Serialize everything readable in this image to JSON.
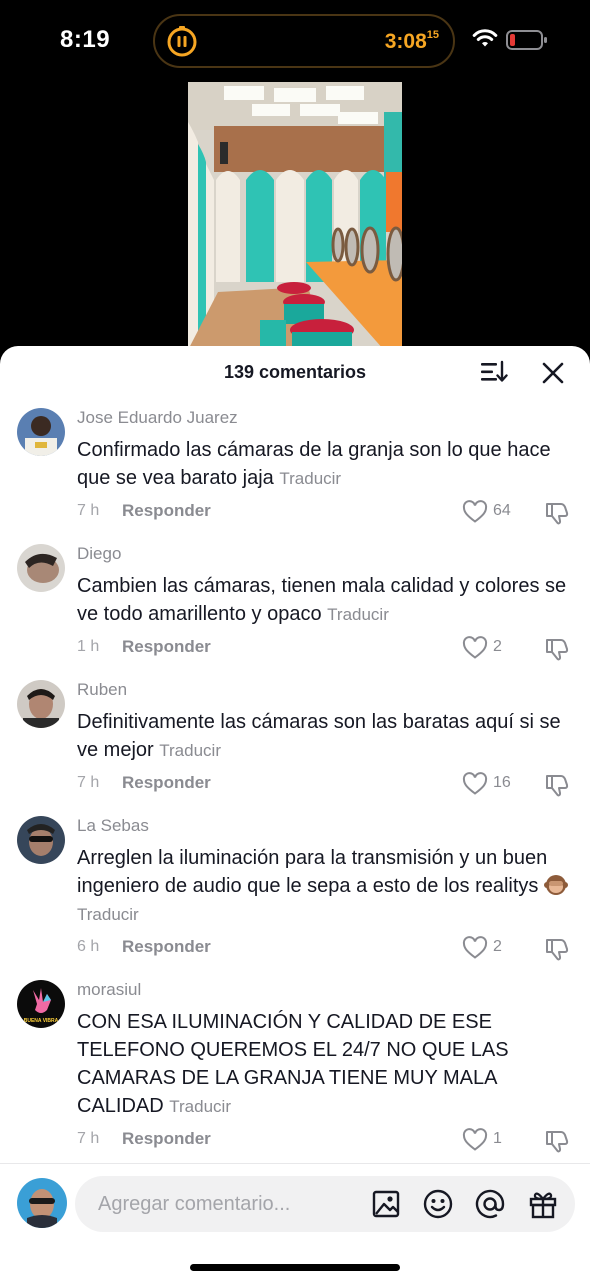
{
  "status": {
    "time": "8:19",
    "timer_main": "3:08",
    "timer_sup": "15",
    "battery_color": "#e53935",
    "timer_color": "#f6a623"
  },
  "sheet": {
    "count_label": "139 comentarios"
  },
  "comments": [
    {
      "user": "Jose Eduardo Juarez",
      "text": "Confirmado las cámaras de la granja son lo que hace que se vea barato jaja",
      "translate": "Traducir",
      "time": "7 h",
      "reply": "Responder",
      "likes": "64"
    },
    {
      "user": "Diego",
      "text": "Cambien las cámaras, tienen mala calidad y colores se ve todo amarillento y opaco",
      "translate": "Traducir",
      "time": "1 h",
      "reply": "Responder",
      "likes": "2"
    },
    {
      "user": "Ruben",
      "text": "Definitivamente las cámaras son las baratas aquí si se ve mejor",
      "translate": "Traducir",
      "time": "7 h",
      "reply": "Responder",
      "likes": "16"
    },
    {
      "user": "La Sebas",
      "text": "Arreglen la iluminación para la transmisión y un buen ingeniero de audio que le sepa a esto de los realitys",
      "translate": "Traducir",
      "time": "6 h",
      "reply": "Responder",
      "likes": "2",
      "emoji": "monkey-emoji"
    },
    {
      "user": "morasiul",
      "text": "CON ESA ILUMINACIÓN Y CALIDAD DE ESE TELEFONO QUEREMOS EL 24/7 NO QUE LAS CAMARAS DE LA GRANJA TIENE MUY MALA CALIDAD",
      "translate": "Traducir",
      "time": "7 h",
      "reply": "Responder",
      "likes": "1",
      "avatar_text": "BUENA VIBRA"
    }
  ],
  "input": {
    "placeholder": "Agregar comentario..."
  }
}
